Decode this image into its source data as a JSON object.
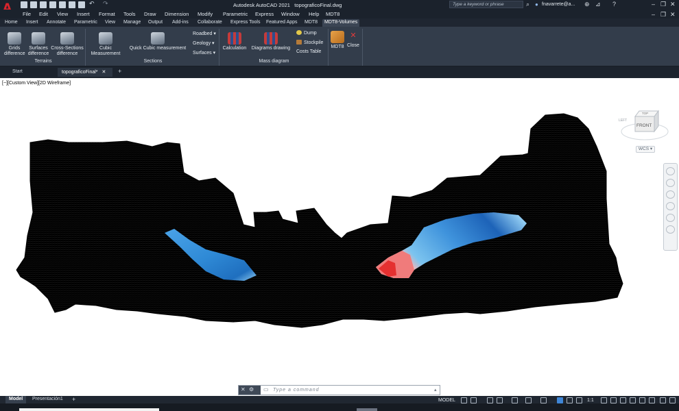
{
  "app": {
    "logo": "A",
    "title": "Autodesk AutoCAD 2021",
    "document": "topograficoFinal.dwg",
    "search_placeholder": "Type a keyword or phrase",
    "user": "fnavarrete@a..."
  },
  "menu": [
    "File",
    "Edit",
    "View",
    "Insert",
    "Format",
    "Tools",
    "Draw",
    "Dimension",
    "Modify",
    "Parametric",
    "Express",
    "Window",
    "Help",
    "MDT8"
  ],
  "ribbon_tabs": [
    "Home",
    "Insert",
    "Annotate",
    "Parametric",
    "View",
    "Manage",
    "Output",
    "Add-ins",
    "Collaborate",
    "Express Tools",
    "Featured Apps",
    "MDT8",
    "MDT8-Volumes"
  ],
  "ribbon": {
    "terrains": {
      "label": "Terrains",
      "grids": "Grids\ndifference",
      "surfaces": "Surfaces\ndifference",
      "cross": "Cross-Sections\ndifference"
    },
    "sections": {
      "label": "Sections",
      "cubic": "Cubic\nMeasurement",
      "quick": "Quick Cubic measurement",
      "roadbed": "Roadbed",
      "geology": "Geology",
      "surfaces": "Surfaces"
    },
    "mass": {
      "label": "Mass diagram",
      "calculation": "Calculation",
      "diagrams": "Diagrams drawing",
      "dump": "Dump",
      "stockpile": "Stockpile",
      "costs": "Costs Table"
    },
    "mdt8": "MDT8",
    "close": "Close"
  },
  "doc_tabs": [
    "Start",
    "topograficoFinal*"
  ],
  "viewport_label": "[−][Custom View][2D Wireframe]",
  "viewcube": {
    "face": "FRONT",
    "top": "TOP",
    "left": "LEFT",
    "wcs": "WCS"
  },
  "command": {
    "placeholder": "Type a command"
  },
  "layout_tabs": [
    "Model",
    "Presentación1"
  ],
  "status": {
    "model": "MODEL",
    "scale": "1:1"
  },
  "colors": {
    "accent": "#3f86d7",
    "cut": "#e53030",
    "fill": "#1f6fbf",
    "terrain": "#000000"
  }
}
